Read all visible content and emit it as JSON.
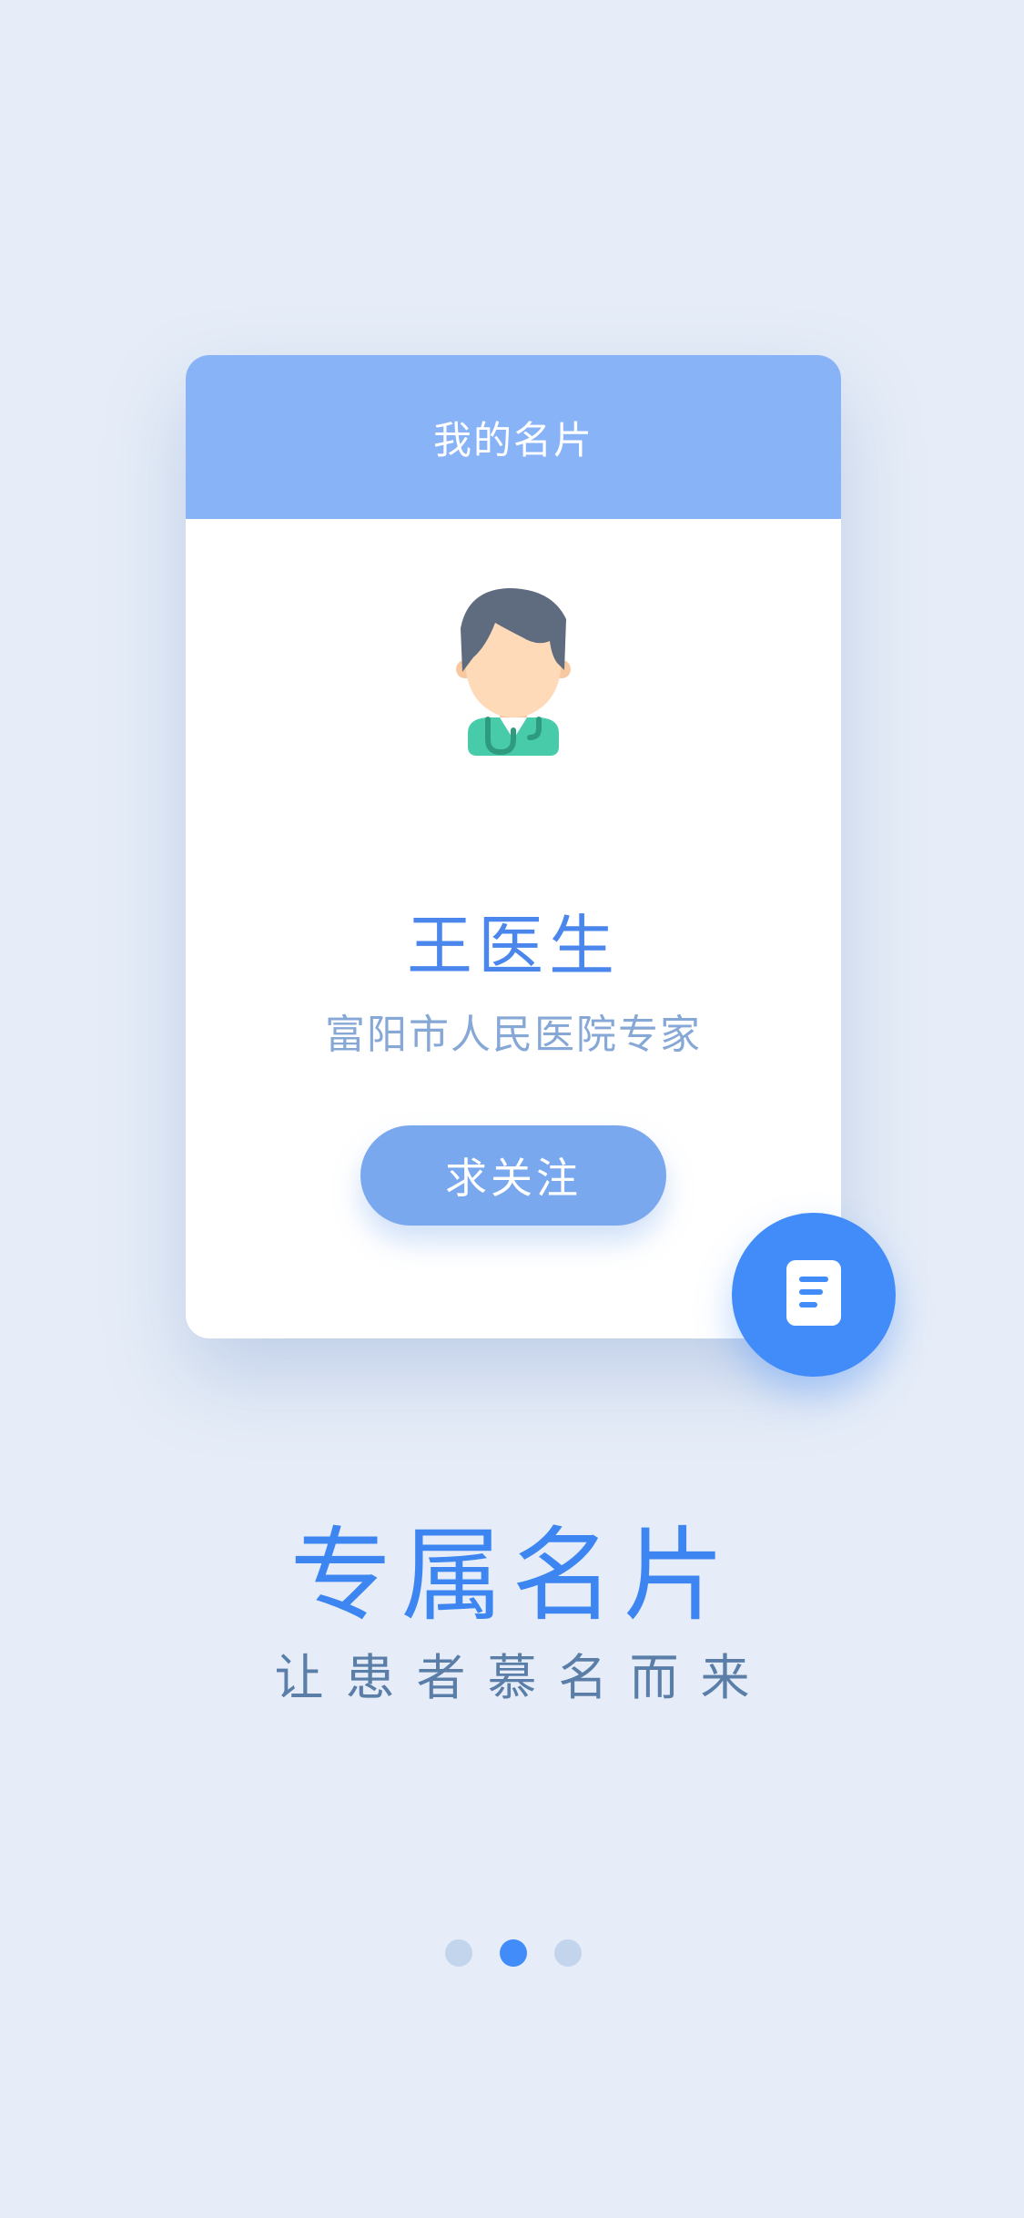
{
  "card": {
    "header_title": "我的名片",
    "doctor_name": "王医生",
    "doctor_title": "富阳市人民医院专家",
    "follow_label": "求关注",
    "avatar_icon": "doctor-avatar-icon",
    "fab_icon": "document-icon"
  },
  "intro": {
    "headline": "专属名片",
    "subheadline": "让患者慕名而来"
  },
  "pager": {
    "current_page": 2,
    "total_pages": 3
  },
  "colors": {
    "background": "#e6edf8",
    "header": "#89b3f7",
    "accent": "#418cf9",
    "button": "#7aa8ee",
    "name_text": "#4a86ec",
    "subtitle_text": "#86a8d6"
  }
}
